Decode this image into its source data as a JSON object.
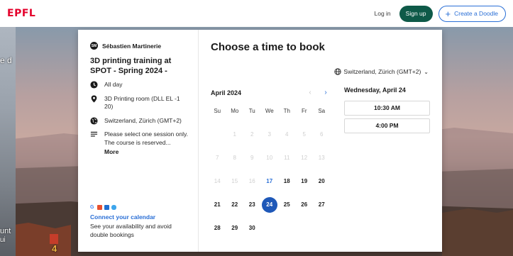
{
  "header": {
    "logo": "EPFL",
    "login_label": "Log in",
    "signup_label": "Sign up",
    "create_label": "Create a Doodle"
  },
  "background": {
    "left_text_top": "e d",
    "left_text_bottom_1": "unt",
    "left_text_bottom_2": "ui",
    "building_number": "4"
  },
  "sidebar": {
    "avatar_initials": "SM",
    "organizer": "Sébastien Martinerie",
    "title": "3D printing training at SPOT - Spring 2024 -",
    "duration": "All day",
    "location": "3D Printing room (DLL EL -1 20)",
    "timezone": "Switzerland, Zürich (GMT+2)",
    "description": "Please select one session only. The course is reserved...",
    "more_label": "More",
    "connect_link": "Connect your calendar",
    "connect_desc": "See your availability and avoid double bookings"
  },
  "main": {
    "heading": "Choose a time to book",
    "timezone_label": "Switzerland, Zürich (GMT+2)",
    "month_label": "April 2024",
    "weekdays": [
      "Su",
      "Mo",
      "Tu",
      "We",
      "Th",
      "Fr",
      "Sa"
    ],
    "weeks": [
      [
        {
          "d": "",
          "s": "empty"
        },
        {
          "d": "1",
          "s": "dim"
        },
        {
          "d": "2",
          "s": "dim"
        },
        {
          "d": "3",
          "s": "dim"
        },
        {
          "d": "4",
          "s": "dim"
        },
        {
          "d": "5",
          "s": "dim"
        },
        {
          "d": "6",
          "s": "dim"
        }
      ],
      [
        {
          "d": "7",
          "s": "dim"
        },
        {
          "d": "8",
          "s": "dim"
        },
        {
          "d": "9",
          "s": "dim"
        },
        {
          "d": "10",
          "s": "dim"
        },
        {
          "d": "11",
          "s": "dim"
        },
        {
          "d": "12",
          "s": "dim"
        },
        {
          "d": "13",
          "s": "dim"
        }
      ],
      [
        {
          "d": "14",
          "s": "dim"
        },
        {
          "d": "15",
          "s": "dim"
        },
        {
          "d": "16",
          "s": "dim"
        },
        {
          "d": "17",
          "s": "today"
        },
        {
          "d": "18",
          "s": "av"
        },
        {
          "d": "19",
          "s": "av"
        },
        {
          "d": "20",
          "s": "av"
        }
      ],
      [
        {
          "d": "21",
          "s": "av"
        },
        {
          "d": "22",
          "s": "av"
        },
        {
          "d": "23",
          "s": "av"
        },
        {
          "d": "24",
          "s": "sel"
        },
        {
          "d": "25",
          "s": "av"
        },
        {
          "d": "26",
          "s": "av"
        },
        {
          "d": "27",
          "s": "av"
        }
      ],
      [
        {
          "d": "28",
          "s": "av"
        },
        {
          "d": "29",
          "s": "av"
        },
        {
          "d": "30",
          "s": "av"
        },
        {
          "d": "",
          "s": "empty"
        },
        {
          "d": "",
          "s": "empty"
        },
        {
          "d": "",
          "s": "empty"
        },
        {
          "d": "",
          "s": "empty"
        }
      ]
    ],
    "selected_day_label": "Wednesday, April 24",
    "time_slots": [
      "10:30 AM",
      "4:00 PM"
    ]
  },
  "colors": {
    "brand_red": "#e4002b",
    "signup_green": "#0e5a48",
    "link_blue": "#2a6fd6",
    "selected_blue": "#1e58b8"
  }
}
